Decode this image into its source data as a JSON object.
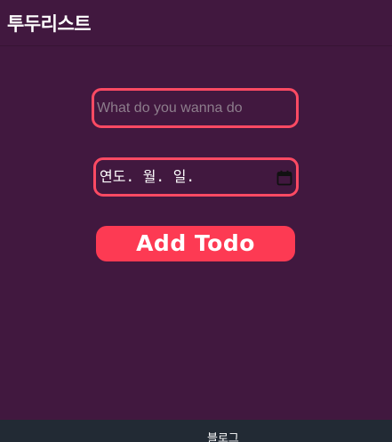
{
  "header": {
    "title": "투두리스트"
  },
  "form": {
    "todo_input": {
      "placeholder": "What do you wanna do",
      "value": ""
    },
    "date_input": {
      "display": "연도. 월. 일.",
      "icon": "calendar-icon"
    },
    "submit_label": "Add Todo"
  },
  "bottom_nav": {
    "link_label": "블로그"
  },
  "colors": {
    "background": "#41183f",
    "accent": "#fd3a53",
    "field_border": "#fc4a63",
    "bottom_bar": "#222a34"
  }
}
